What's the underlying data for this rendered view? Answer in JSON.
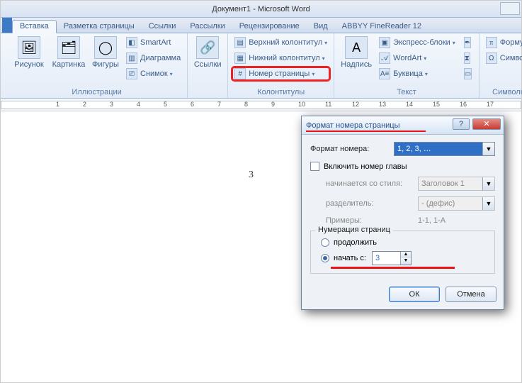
{
  "title": "Документ1 - Microsoft Word",
  "tabs": {
    "file": "",
    "insert": "Вставка",
    "layout": "Разметка страницы",
    "refs": "Ссылки",
    "mail": "Рассылки",
    "review": "Рецензирование",
    "view": "Вид",
    "abbyy": "ABBYY FineReader 12"
  },
  "groups": {
    "illustrations": {
      "label": "Иллюстрации",
      "picture": "Рисунок",
      "clipart": "Картинка",
      "shapes": "Фигуры",
      "smartart": "SmartArt",
      "chart": "Диаграмма",
      "screenshot": "Снимок"
    },
    "links": {
      "label": "",
      "links": "Ссылки"
    },
    "headerfooter": {
      "label": "Колонтитулы",
      "header": "Верхний колонтитул",
      "footer": "Нижний колонтитул",
      "pagenum": "Номер страницы"
    },
    "text": {
      "label": "Текст",
      "textbox": "Надпись",
      "quickparts": "Экспресс-блоки",
      "wordart": "WordArt",
      "dropcap": "Буквица"
    },
    "symbols": {
      "label": "Символы",
      "equation": "Формула",
      "symbol": "Символ"
    }
  },
  "page_number_shown": "3",
  "dialog": {
    "title": "Формат номера страницы",
    "format_label": "Формат номера:",
    "format_value": "1, 2, 3, …",
    "include_chapter": "Включить номер главы",
    "starts_style_label": "начинается со стиля:",
    "starts_style_value": "Заголовок 1",
    "separator_label": "разделитель:",
    "separator_value": "-   (дефис)",
    "examples_label": "Примеры:",
    "examples_value": "1-1, 1-A",
    "numeration_legend": "Нумерация страниц",
    "continue": "продолжить",
    "start_at": "начать с:",
    "start_value": "3",
    "ok": "ОК",
    "cancel": "Отмена",
    "help": "?",
    "close": "✕"
  }
}
